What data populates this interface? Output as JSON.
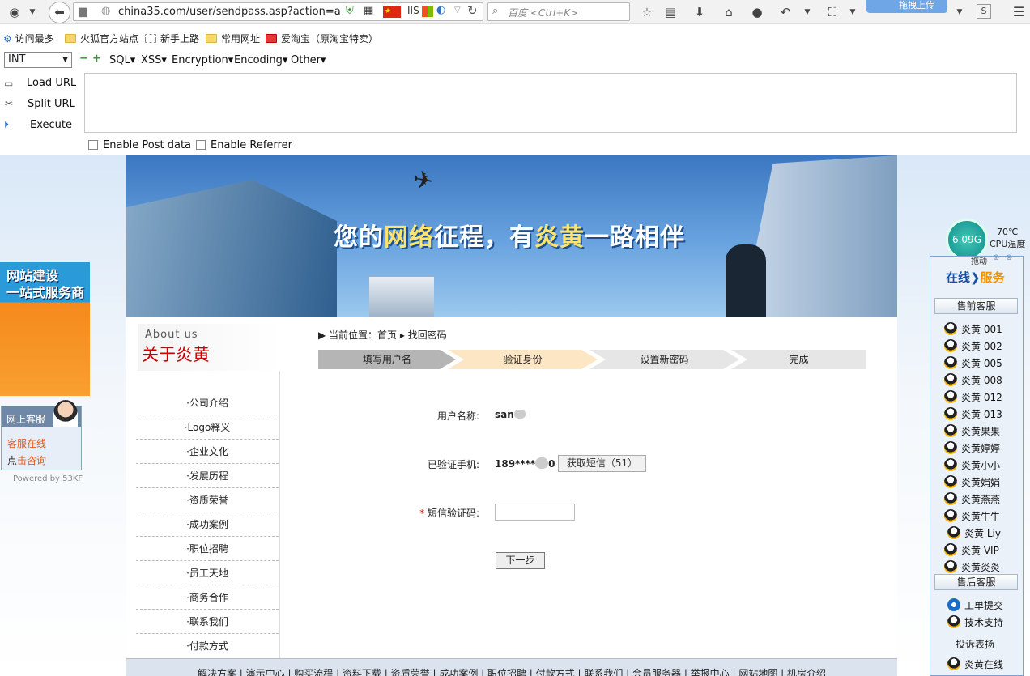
{
  "browser": {
    "url": "china35.com/user/sendpass.asp?action=a",
    "search_placeholder": "百度 <Ctrl+K>",
    "upload_label": "拖拽上传",
    "bookmarks": [
      "访问最多",
      "火狐官方站点",
      "新手上路",
      "常用网址",
      "爱淘宝（原淘宝特卖）"
    ]
  },
  "hackbar": {
    "int_select": "INT",
    "menus": [
      "SQL▾",
      "XSS▾",
      "Encryption▾",
      "Encoding▾",
      "Other▾"
    ],
    "load_url": "Load URL",
    "split_url": "Split URL",
    "execute": "Execute",
    "enable_post": "Enable Post data",
    "enable_referrer": "Enable Referrer"
  },
  "banner": {
    "slogan_a": "您的",
    "slogan_b": "网络",
    "slogan_c": "征程，有",
    "slogan_d": "炎黄",
    "slogan_e": "一路相伴"
  },
  "sidebar": {
    "about_en": "About us",
    "about_cn": "关于炎黄",
    "items": [
      "·公司介绍",
      "·Logo释义",
      "·企业文化",
      "·发展历程",
      "·资质荣誉",
      "·成功案例",
      "·职位招聘",
      "·员工天地",
      "·商务合作",
      "·联系我们",
      "·付款方式"
    ]
  },
  "main": {
    "breadcrumb": "▶ 当前位置：首页 ▸ 找回密码",
    "steps": [
      "填写用户名",
      "验证身份",
      "设置新密码",
      "完成"
    ],
    "username_label": "用户名称:",
    "username_value": "san",
    "phone_label": "已验证手机:",
    "phone_value": "189****",
    "phone_tail": "0",
    "sms_button": "获取短信（51）",
    "required_mark": "*",
    "code_label": "短信验证码:",
    "next_button": "下一步"
  },
  "footer": {
    "links": "解决方案 | 演示中心 | 购买流程 | 资料下载 | 资质荣誉 | 成功案例 | 职位招聘 | 付款方式 | 联系我们 | 会员服务器 | 举报中心 | 网站地图 | 机房介绍"
  },
  "left_float": {
    "ad_line1": "网站建设",
    "ad_line2": "一站式服务商",
    "kf_title": "网上客服",
    "kf_online": "客服在线",
    "kf_click_a": "点",
    "kf_click_b": "击咨询",
    "powered": "Powered by 53KF"
  },
  "right_float": {
    "gauge": "6.09G",
    "temp": "70℃",
    "cpu_label": "CPU温度",
    "drag": "拖动",
    "title_a": "在线",
    "title_b": "服务",
    "presale": "售前客服",
    "presale_items": [
      "炎黄 001",
      "炎黄 002",
      "炎黄 005",
      "炎黄 008",
      "炎黄 012",
      "炎黄 013",
      "炎黄果果",
      "炎黄婷婷",
      "炎黄小小",
      "炎黄娟娟",
      "炎黄燕燕",
      "炎黄牛牛",
      "炎黄 Liy",
      "炎黄 VIP",
      "炎黄炎炎"
    ],
    "aftersale": "售后客服",
    "after_items": [
      "工单提交",
      "技术支持"
    ],
    "complaint": "投诉表扬",
    "last_item": "炎黄在线"
  },
  "colors": {
    "step_done": "#b5b5b5",
    "step_active": "#fde6c4",
    "step_todo": "#e6e6e6",
    "about_red": "#cc0000"
  }
}
